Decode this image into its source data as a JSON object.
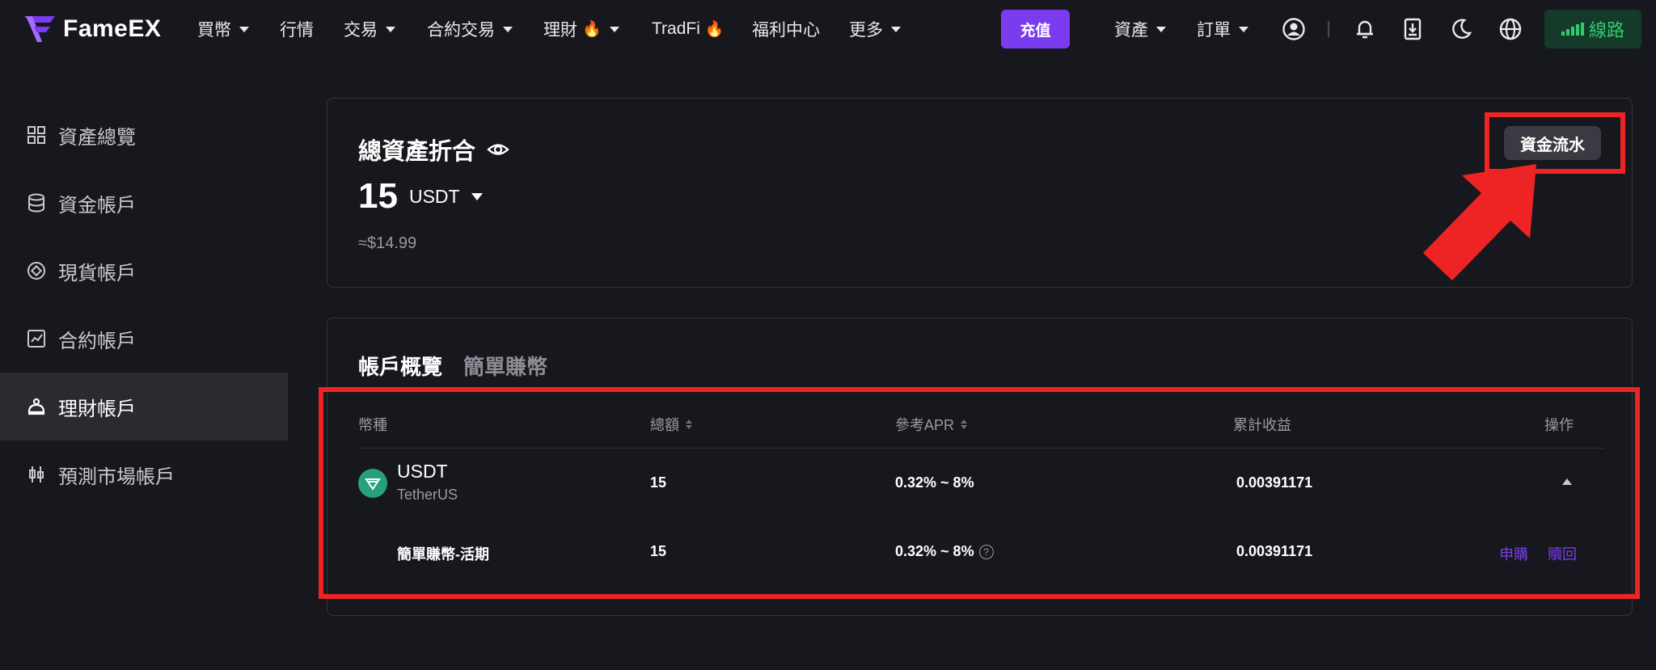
{
  "header": {
    "logo_text": "FameEX",
    "nav": [
      {
        "label": "買幣",
        "dropdown": true
      },
      {
        "label": "行情",
        "dropdown": false
      },
      {
        "label": "交易",
        "dropdown": true
      },
      {
        "label": "合約交易",
        "dropdown": true
      },
      {
        "label": "理財",
        "dropdown": true,
        "hot": true
      },
      {
        "label": "TradFi",
        "dropdown": false,
        "hot": true
      },
      {
        "label": "福利中心",
        "dropdown": false
      },
      {
        "label": "更多",
        "dropdown": true
      }
    ],
    "deposit_label": "充值",
    "assets_label": "資產",
    "orders_label": "訂單",
    "network_label": "線路",
    "icons": [
      "account-icon",
      "bell-icon",
      "download-icon",
      "moon-icon",
      "globe-icon"
    ]
  },
  "sidebar": {
    "items": [
      {
        "label": "資產總覽",
        "icon": "grid-icon"
      },
      {
        "label": "資金帳戶",
        "icon": "database-icon"
      },
      {
        "label": "現貨帳戶",
        "icon": "target-icon"
      },
      {
        "label": "合約帳戶",
        "icon": "chart-icon"
      },
      {
        "label": "理財帳戶",
        "icon": "wealth-icon",
        "active": true
      },
      {
        "label": "預測市場帳戶",
        "icon": "candles-icon"
      }
    ]
  },
  "summary": {
    "title": "總資產折合",
    "amount": "15",
    "unit": "USDT",
    "approx": "≈$14.99",
    "flow_button": "資金流水"
  },
  "account": {
    "tabs": [
      "帳戶概覽",
      "簡單賺幣"
    ],
    "columns": [
      "幣種",
      "總額",
      "參考APR",
      "累計收益",
      "操作"
    ],
    "row": {
      "coin": "USDT",
      "coin_full": "TetherUS",
      "total": "15",
      "apr": "0.32% ~ 8%",
      "earnings": "0.00391171"
    },
    "subrow": {
      "product": "簡單賺幣-活期",
      "total": "15",
      "apr": "0.32% ~ 8%",
      "earnings": "0.00391171",
      "subscribe": "申購",
      "redeem": "贖回"
    }
  },
  "colors": {
    "accent": "#7b3cf0",
    "background": "#17181d",
    "annotation_red": "#ee2424",
    "network_green": "#2ecc71",
    "usdt_green": "#26a17b"
  }
}
